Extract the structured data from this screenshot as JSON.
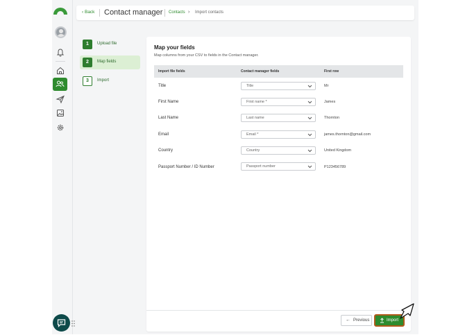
{
  "header": {
    "back_label": "Back",
    "title": "Contact manager",
    "breadcrumb": [
      "Contacts",
      "Import contacts"
    ]
  },
  "steps": [
    {
      "number": "1",
      "label": "Upload file",
      "state": "done"
    },
    {
      "number": "2",
      "label": "Map fields",
      "state": "active"
    },
    {
      "number": "3",
      "label": "Import",
      "state": "pending"
    }
  ],
  "panel": {
    "title": "Map your fields",
    "subtitle": "Map columns from your CSV to fields in the Contact manager.",
    "columns": [
      "Import file fields",
      "Contact manager fields",
      "First row"
    ],
    "rows": [
      {
        "field": "Title",
        "mapping": "Title",
        "first": "Mr"
      },
      {
        "field": "First Name",
        "mapping": "First name *",
        "first": "James"
      },
      {
        "field": "Last Name",
        "mapping": "Last name",
        "first": "Thornton"
      },
      {
        "field": "Email",
        "mapping": "Email *",
        "first": "james.thornton@gmail.com"
      },
      {
        "field": "Country",
        "mapping": "Country",
        "first": "United Kingdom"
      },
      {
        "field": "Passport Number / ID Number",
        "mapping": "Passport number",
        "first": "P123456789"
      }
    ]
  },
  "footer": {
    "previous_label": "Previous",
    "import_label": "Import"
  },
  "sidebar": {
    "icons": [
      "bell-icon",
      "home-icon",
      "contacts-icon",
      "send-icon",
      "image-icon",
      "settings-icon"
    ]
  },
  "colors": {
    "brand_green": "#2e8b2e",
    "active_step_bg": "#dcefd4",
    "chat_button": "#0e4a4a",
    "import_outline": "#b05a1a"
  }
}
